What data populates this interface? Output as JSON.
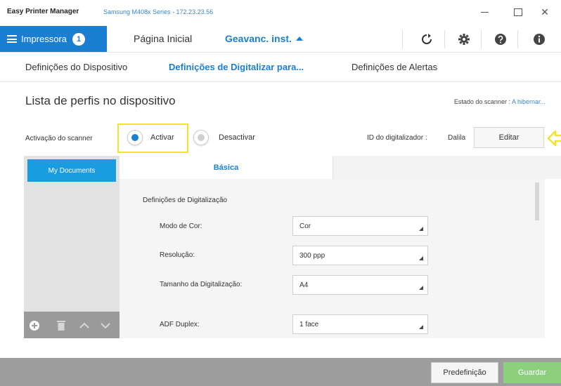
{
  "window": {
    "app_title": "Easy Printer Manager",
    "device": "Samsung M408x Series - 172.23.23.56",
    "min_icon": "minimize-icon",
    "max_icon": "maximize-icon",
    "close_glyph": "✕"
  },
  "nav": {
    "printer_label": "Impressora",
    "printer_badge": "1",
    "home": "Página Inicial",
    "advanced": "Geavanc. inst.",
    "icons": [
      "refresh-icon",
      "gear-icon",
      "help-icon",
      "info-icon"
    ]
  },
  "subtabs": [
    "Definições do Dispositivo",
    "Definições de Digitalizar para...",
    "Definições de Alertas"
  ],
  "main": {
    "title": "Lista de perfis no dispositivo",
    "scanner_state_label": "Estado do scanner : ",
    "scanner_state_value": "A hibernar...",
    "activation_label": "Activação do scanner",
    "activate": "Activar",
    "deactivate": "Desactivar",
    "activation_selected": "Activar",
    "id_label": "ID do digitalizador :",
    "id_value": "Dalila",
    "edit": "Editar"
  },
  "profiles": {
    "items": [
      "My Documents"
    ],
    "tools": [
      "add-icon",
      "delete-icon",
      "move-up-icon",
      "move-down-icon"
    ]
  },
  "settings": {
    "tab": "Básica",
    "heading": "Definições de Digitalização",
    "fields": [
      {
        "label": "Modo de Cor:",
        "value": "Cor"
      },
      {
        "label": "Resolução:",
        "value": "300 ppp"
      },
      {
        "label": "Tamanho da Digitalização:",
        "value": "A4"
      },
      {
        "label": "ADF Duplex:",
        "value": "1 face"
      }
    ]
  },
  "footer": {
    "default": "Predefinição",
    "save": "Guardar"
  },
  "colors": {
    "accent": "#1a7fd0",
    "highlight": "#f2e32c",
    "save": "#8cd07e"
  }
}
